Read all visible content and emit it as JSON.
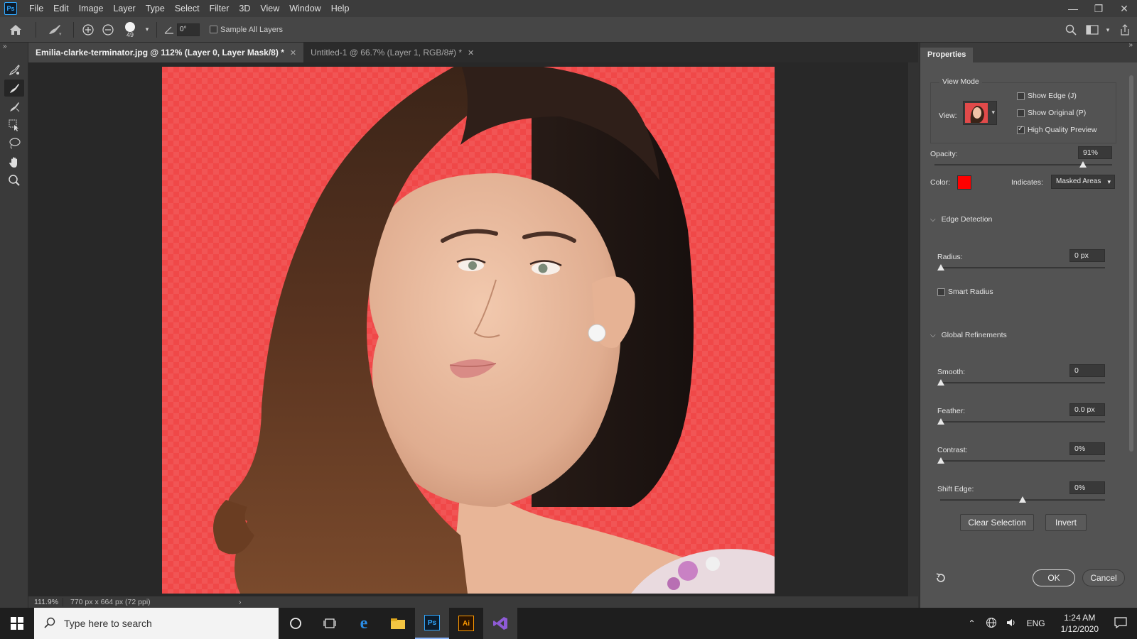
{
  "app": {
    "logo": "Ps"
  },
  "menu": [
    "File",
    "Edit",
    "Image",
    "Layer",
    "Type",
    "Select",
    "Filter",
    "3D",
    "View",
    "Window",
    "Help"
  ],
  "options_bar": {
    "brush_size": "49",
    "angle": "0°",
    "sample_all_layers_label": "Sample All Layers",
    "sample_all_layers": false
  },
  "tabs": [
    {
      "label": "Emilia-clarke-terminator.jpg @ 112% (Layer 0, Layer Mask/8) *",
      "active": true
    },
    {
      "label": "Untitled-1 @ 66.7% (Layer 1, RGB/8#) *",
      "active": false
    }
  ],
  "status": {
    "zoom": "111.9%",
    "doc_size": "770 px x 664 px (72 ppi)"
  },
  "properties": {
    "title": "Properties",
    "view_mode": {
      "heading": "View Mode",
      "view_label": "View:",
      "show_edge": {
        "label": "Show Edge (J)",
        "checked": false
      },
      "show_original": {
        "label": "Show Original (P)",
        "checked": false
      },
      "high_quality": {
        "label": "High Quality Preview",
        "checked": true
      }
    },
    "opacity": {
      "label": "Opacity:",
      "value": "91%",
      "level": 91
    },
    "color": {
      "label": "Color:",
      "swatch": "#ff0000"
    },
    "indicates": {
      "label": "Indicates:",
      "value": "Masked Areas"
    },
    "edge_detection": {
      "heading": "Edge Detection",
      "radius": {
        "label": "Radius:",
        "value": "0 px"
      },
      "smart_radius": {
        "label": "Smart Radius",
        "checked": false
      }
    },
    "global_refinements": {
      "heading": "Global Refinements",
      "smooth": {
        "label": "Smooth:",
        "value": "0"
      },
      "feather": {
        "label": "Feather:",
        "value": "0.0 px"
      },
      "contrast": {
        "label": "Contrast:",
        "value": "0%"
      },
      "shift_edge": {
        "label": "Shift Edge:",
        "value": "0%"
      }
    },
    "buttons": {
      "clear_selection": "Clear Selection",
      "invert": "Invert",
      "ok": "OK",
      "cancel": "Cancel"
    }
  },
  "taskbar": {
    "search_placeholder": "Type here to search",
    "language": "ENG",
    "time": "1:24 AM",
    "date": "1/12/2020"
  }
}
